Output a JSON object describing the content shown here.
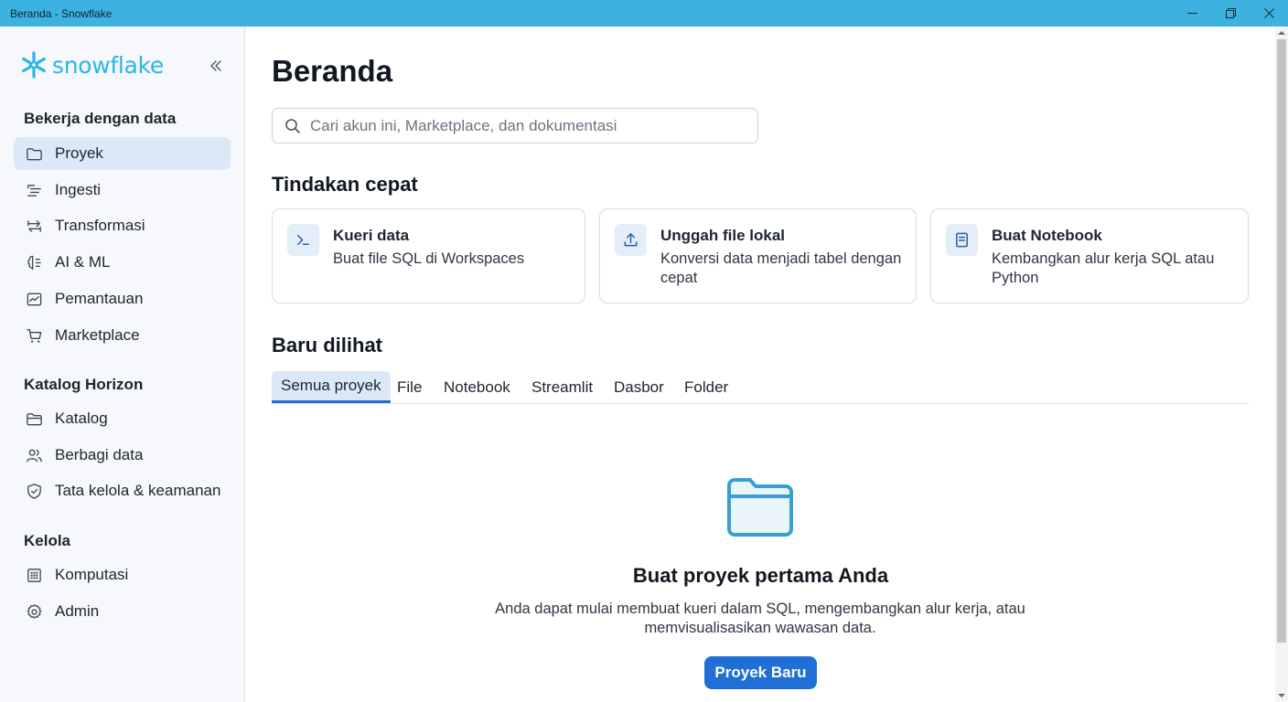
{
  "window": {
    "title": "Beranda - Snowflake",
    "controls": [
      "minimize-icon",
      "restore-icon",
      "close-icon"
    ]
  },
  "sidebar": {
    "logo_text": "snowflake",
    "brand_color": "#29b5e8",
    "sections": [
      {
        "title": "Bekerja dengan data",
        "items": [
          {
            "label": "Proyek",
            "icon": "folder-icon",
            "active": true
          },
          {
            "label": "Ingesti",
            "icon": "ingest-lines-icon"
          },
          {
            "label": "Transformasi",
            "icon": "transform-arrows-icon"
          },
          {
            "label": "AI & ML",
            "icon": "ai-ml-icon"
          },
          {
            "label": "Pemantauan",
            "icon": "monitoring-chart-icon"
          },
          {
            "label": "Marketplace",
            "icon": "cart-icon"
          }
        ]
      },
      {
        "title": "Katalog Horizon",
        "items": [
          {
            "label": "Katalog",
            "icon": "catalog-folder-icon"
          },
          {
            "label": "Berbagi data",
            "icon": "users-icon"
          },
          {
            "label": "Tata kelola & keamanan",
            "icon": "shield-icon"
          }
        ]
      },
      {
        "title": "Kelola",
        "items": [
          {
            "label": "Komputasi",
            "icon": "compute-chip-icon"
          },
          {
            "label": "Admin",
            "icon": "gear-icon"
          }
        ]
      }
    ]
  },
  "main": {
    "title": "Beranda",
    "search": {
      "placeholder": "Cari akun ini, Marketplace, dan dokumentasi",
      "value": ""
    },
    "quick_actions": {
      "title": "Tindakan cepat",
      "cards": [
        {
          "title": "Kueri data",
          "desc": "Buat file SQL di Workspaces",
          "icon": "terminal-icon"
        },
        {
          "title": "Unggah file lokal",
          "desc": "Konversi data menjadi tabel dengan cepat",
          "icon": "upload-icon"
        },
        {
          "title": "Buat Notebook",
          "desc": "Kembangkan alur kerja SQL atau Python",
          "icon": "notebook-icon"
        }
      ]
    },
    "recent": {
      "title": "Baru dilihat",
      "tabs": [
        {
          "label": "Semua proyek",
          "active": true
        },
        {
          "label": "File"
        },
        {
          "label": "Notebook"
        },
        {
          "label": "Streamlit"
        },
        {
          "label": "Dasbor"
        },
        {
          "label": "Folder"
        }
      ]
    },
    "empty_state": {
      "icon": "empty-folder-icon",
      "title": "Buat proyek pertama Anda",
      "desc": "Anda dapat mulai membuat kueri dalam SQL, mengembangkan alur kerja, atau memvisualisasikan wawasan data.",
      "button": "Proyek Baru"
    }
  },
  "colors": {
    "titlebar": "#3db2e1",
    "accent": "#1f6fd6",
    "active_nav": "#dbe8f7"
  }
}
